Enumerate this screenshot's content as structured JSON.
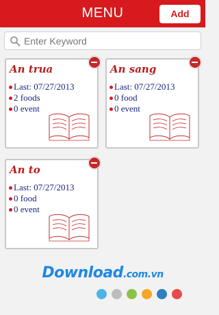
{
  "header": {
    "title": "MENU",
    "add_label": "Add"
  },
  "search": {
    "placeholder": "Enter Keyword"
  },
  "cards": [
    {
      "title": "An trua",
      "last": "Last: 07/27/2013",
      "foods": "2 foods",
      "events": "0 event"
    },
    {
      "title": "An sang",
      "last": "Last: 07/27/2013",
      "foods": "0 food",
      "events": "0 event"
    },
    {
      "title": "An to",
      "last": "Last: 07/27/2013",
      "foods": "0 food",
      "events": "0 event"
    }
  ],
  "footer": {
    "logo_main": "Download",
    "logo_suffix": ".com.vn",
    "dot_colors": [
      "#4fb3e8",
      "#bdbdbd",
      "#8bc34a",
      "#f5a623",
      "#2f7fc1",
      "#e84b4b"
    ]
  },
  "colors": {
    "accent": "#d61a1e",
    "title": "#b71c1c",
    "text": "#1a237e"
  }
}
